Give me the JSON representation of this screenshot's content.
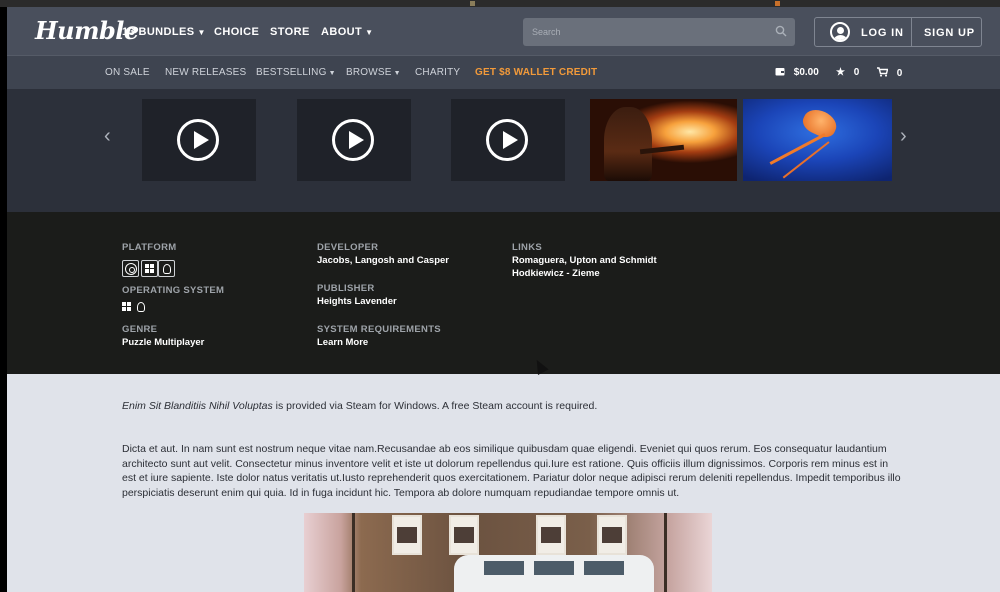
{
  "header": {
    "logo": "Humble",
    "nav": [
      {
        "label": "13 BUNDLES",
        "dropdown": true
      },
      {
        "label": "CHOICE",
        "dropdown": false
      },
      {
        "label": "STORE",
        "dropdown": false
      },
      {
        "label": "ABOUT",
        "dropdown": true
      }
    ],
    "search_placeholder": "Search",
    "login_label": "LOG IN",
    "signup_label": "SIGN UP"
  },
  "subnav": {
    "links": [
      {
        "label": "ON SALE",
        "dropdown": false
      },
      {
        "label": "NEW RELEASES",
        "dropdown": false
      },
      {
        "label": "BESTSELLING",
        "dropdown": true
      },
      {
        "label": "BROWSE",
        "dropdown": true
      },
      {
        "label": "CHARITY",
        "dropdown": false
      }
    ],
    "promo": "GET $8 WALLET CREDIT",
    "wallet": "$0.00",
    "wishlist_count": "0",
    "cart_count": "0"
  },
  "details": {
    "platform_label": "PLATFORM",
    "os_label": "OPERATING SYSTEM",
    "genre_label": "GENRE",
    "genre_value": "Puzzle Multiplayer",
    "developer_label": "DEVELOPER",
    "developer_value": "Jacobs, Langosh and Casper",
    "publisher_label": "PUBLISHER",
    "publisher_value": "Heights Lavender",
    "sysreq_label": "SYSTEM REQUIREMENTS",
    "sysreq_value": "Learn More",
    "links_label": "LINKS",
    "links": [
      "Romaguera, Upton and Schmidt",
      "Hodkiewicz - Zieme"
    ]
  },
  "description": {
    "game_title": "Enim Sit Blanditiis Nihil Voluptas",
    "intro_rest": " is provided via Steam for Windows. A free Steam account is required.",
    "paragraph": "Dicta et aut. In nam sunt est nostrum neque vitae nam.Recusandae ab eos similique quibusdam quae eligendi. Eveniet qui quos rerum. Eos consequatur laudantium architecto sunt aut velit. Consectetur minus inventore velit et iste ut dolorum repellendus qui.Iure est ratione. Quis officiis illum dignissimos. Corporis rem minus est in est et iure sapiente. Iste dolor natus veritatis ut.Iusto reprehenderit quos exercitationem. Pariatur dolor neque adipisci rerum deleniti repellendus. Impedit temporibus illo perspiciatis deserunt enim qui quia. Id in fuga incidunt hic. Tempora ab dolore numquam repudiandae tempore omnis ut."
  },
  "icons": {
    "prev": "chevron-left-icon",
    "next": "chevron-right-icon",
    "play": "play-icon",
    "wallet": "wallet-icon",
    "wishlist": "star-icon",
    "cart": "cart-icon",
    "platform": [
      "steam-icon",
      "windows-icon",
      "linux-icon"
    ],
    "os": [
      "windows-icon",
      "linux-icon"
    ]
  }
}
